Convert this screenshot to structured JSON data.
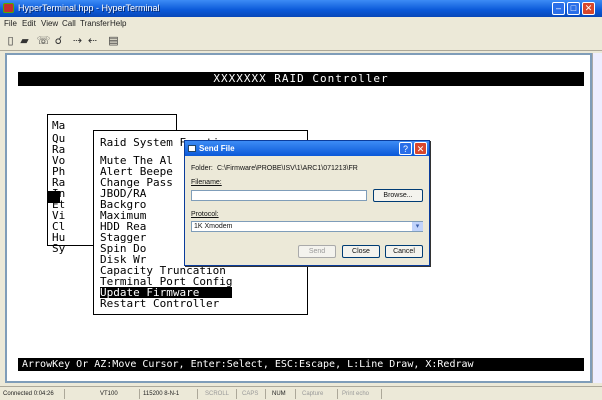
{
  "window": {
    "title": "HyperTerminal.hpp - HyperTerminal",
    "min_glyph": "–",
    "max_glyph": "□",
    "close_glyph": "✕"
  },
  "menu": [
    "File",
    "Edit",
    "View",
    "Call",
    "Transfer",
    "Help"
  ],
  "toolbar_icons": [
    "new-icon",
    "open-icon",
    "phone-icon",
    "disconnect-icon",
    "send-icon",
    "receive-icon",
    "properties-icon"
  ],
  "terminal": {
    "header": "XXXXXXX RAID Controller",
    "main_menu": {
      "name_label": "Ma",
      "items": [
        "Qu",
        "Ra",
        "Vo",
        "Ph",
        "Ra",
        "In",
        "Et",
        "Vi",
        "Cl",
        "Hu",
        "Sy"
      ]
    },
    "function_menu": {
      "title": "Raid System Function",
      "items": [
        "Mute The Al",
        "Alert Beepe",
        "Change Pass",
        "JBOD/RA",
        "Backgro",
        "Maximum",
        "HDD Rea",
        "Stagger",
        "Spin Do",
        "Disk Wr",
        "Capacity Truncation",
        "Terminal Port Config",
        "Update Firmware",
        "Restart Controller"
      ],
      "selected_index": 12
    },
    "footer": "ArrowKey Or AZ:Move Cursor, Enter:Select, ESC:Escape, L:Line Draw, X:Redraw"
  },
  "dialog": {
    "title": "Send File",
    "folder_label": "Folder:",
    "folder_value": "C:\\Firmware\\PROBE\\ISV\\1\\ARC1\\071213\\FR",
    "filename_label": "Filename:",
    "filename_value": "",
    "browse_label": "Browse...",
    "protocol_label": "Protocol:",
    "protocol_value": "1K Xmodem",
    "send_label": "Send",
    "close_label": "Close",
    "cancel_label": "Cancel",
    "help_glyph": "?",
    "close_glyph": "✕"
  },
  "status": {
    "connected": "Connected 0:04:26",
    "terminal_type": "VT100",
    "settings": "115200 8-N-1",
    "scroll": "SCROLL",
    "caps": "CAPS",
    "num": "NUM",
    "capture": "Capture",
    "print_echo": "Print echo"
  }
}
